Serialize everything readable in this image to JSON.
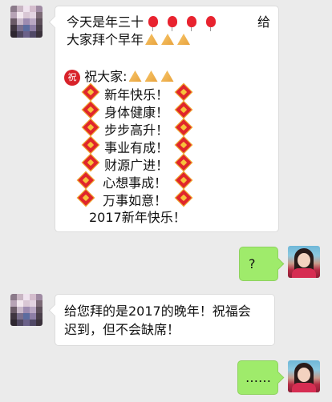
{
  "messages": [
    {
      "side": "left",
      "lines": {
        "l1_text": "今天是年三十",
        "l1_end": "给",
        "l2_text": "大家拜个早年",
        "l3_text": "祝大家:",
        "l3_badge": "祝",
        "blessings": [
          "新年快乐！",
          "身体健康！",
          "步步高升！",
          "事业有成！",
          "财源广进！",
          "心想事成！",
          "万事如意！"
        ],
        "last": "2017新年快乐！"
      }
    },
    {
      "side": "right",
      "text": "?"
    },
    {
      "side": "left",
      "text_l1": "给您拜的是2017的晚年！祝福会",
      "text_l2": "迟到，但不会缺席！"
    },
    {
      "side": "right",
      "text": "……"
    }
  ],
  "icons": {
    "balloon": "red-balloon-icon",
    "pray": "praying-hands-icon",
    "fu": "fu-diamond-icon",
    "zhu": "zhu-badge-icon"
  },
  "colors": {
    "background": "#ebebeb",
    "bubble_in": "#ffffff",
    "bubble_out": "#9feb6b"
  }
}
